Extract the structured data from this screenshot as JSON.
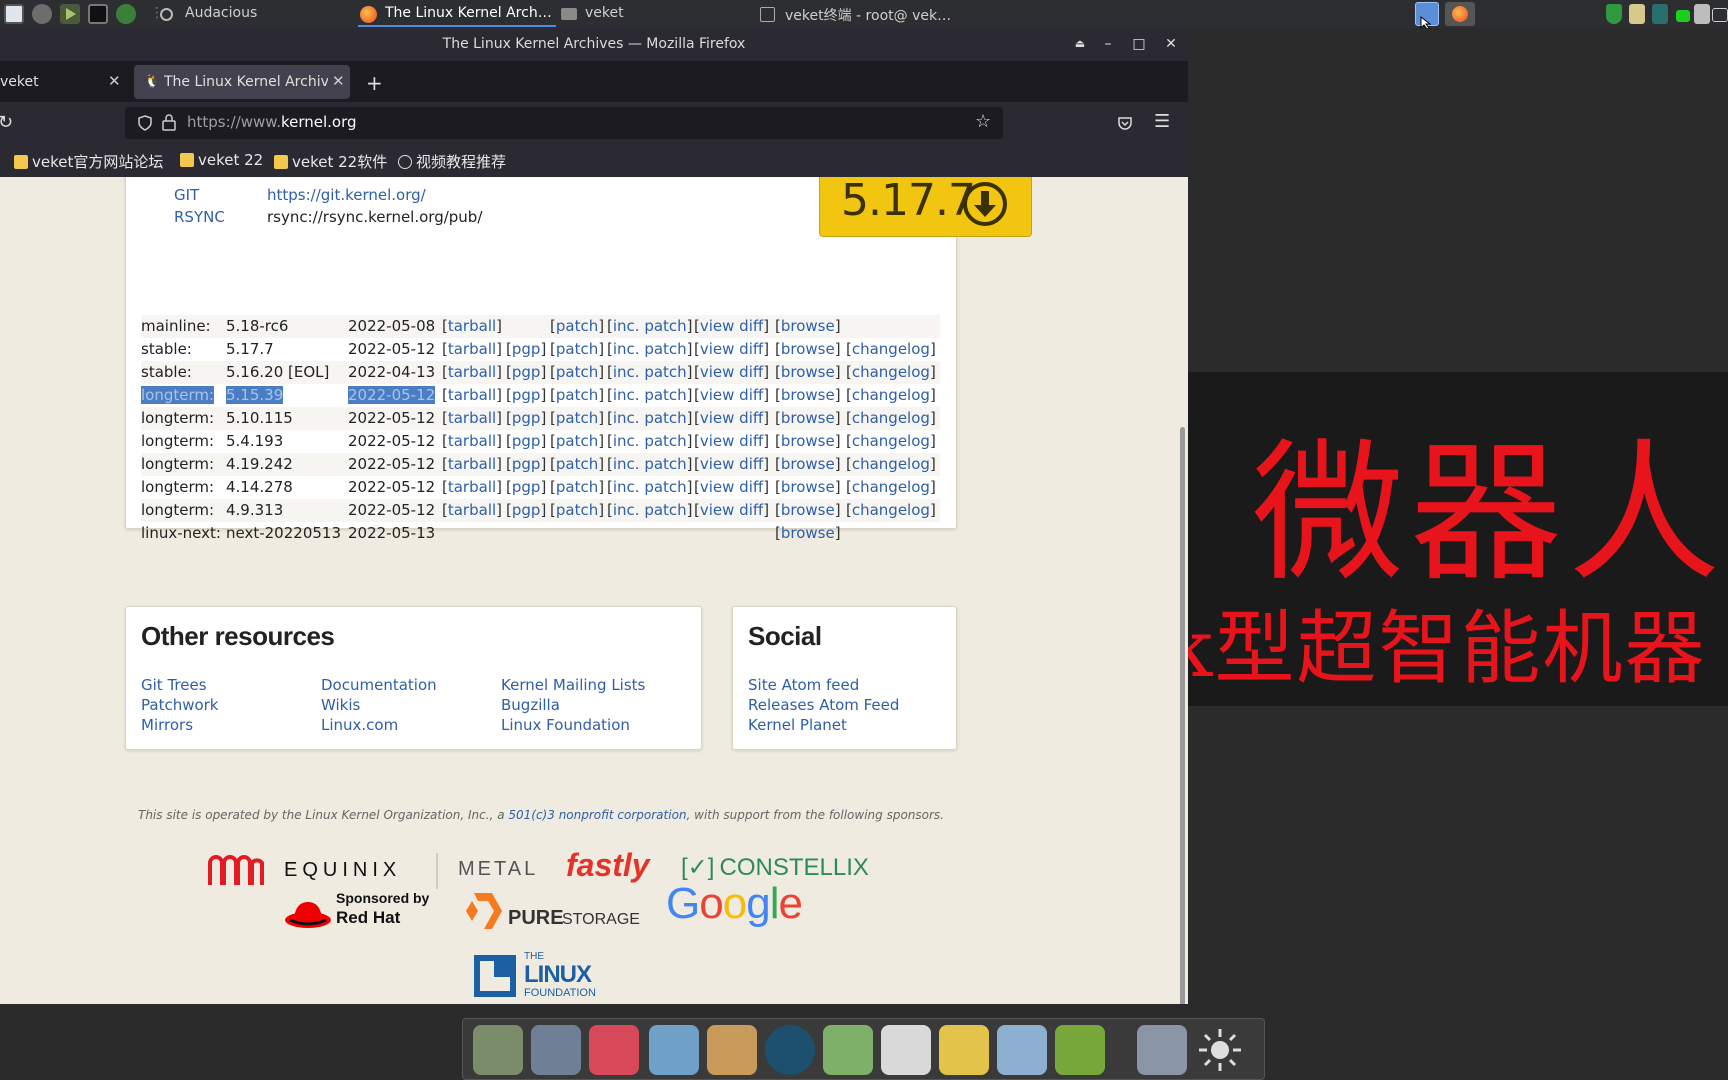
{
  "topbar": {
    "app_audacious": "Audacious",
    "task_firefox": "The Linux Kernel Arch…",
    "task_files": "veket",
    "task_terminal": "veket终端 - root@ vek…"
  },
  "window": {
    "title": "The Linux Kernel Archives — Mozilla Firefox"
  },
  "tabs": [
    {
      "label": "veket"
    },
    {
      "label": "The Linux Kernel Archive"
    }
  ],
  "urlbar": {
    "prefix": "https://www.",
    "domain": "kernel.org"
  },
  "bookmarks": [
    {
      "label": "veket官方网站论坛"
    },
    {
      "label": "veket 22"
    },
    {
      "label": "veket 22软件"
    },
    {
      "label": "视频教程推荐"
    }
  ],
  "protocols": [
    {
      "name": "GIT",
      "url": "https://git.kernel.org/"
    },
    {
      "name": "RSYNC",
      "url": "rsync://rsync.kernel.org/pub/"
    }
  ],
  "latest_release": "5.17.7",
  "releases": [
    {
      "kind": "mainline:",
      "version": "5.18-rc6",
      "date": "2022-05-08",
      "tarball": "tarball",
      "pgp": "",
      "patch": "patch",
      "inc": "inc. patch",
      "diff": "view diff",
      "browse": "browse",
      "changelog": ""
    },
    {
      "kind": "stable:",
      "version": "5.17.7",
      "date": "2022-05-12",
      "tarball": "tarball",
      "pgp": "pgp",
      "patch": "patch",
      "inc": "inc. patch",
      "diff": "view diff",
      "browse": "browse",
      "changelog": "changelog"
    },
    {
      "kind": "stable:",
      "version": "5.16.20 [EOL]",
      "date": "2022-04-13",
      "tarball": "tarball",
      "pgp": "pgp",
      "patch": "patch",
      "inc": "inc. patch",
      "diff": "view diff",
      "browse": "browse",
      "changelog": "changelog"
    },
    {
      "kind": "longterm:",
      "version": "5.15.39",
      "date": "2022-05-12",
      "tarball": "tarball",
      "pgp": "pgp",
      "patch": "patch",
      "inc": "inc. patch",
      "diff": "view diff",
      "browse": "browse",
      "changelog": "changelog"
    },
    {
      "kind": "longterm:",
      "version": "5.10.115",
      "date": "2022-05-12",
      "tarball": "tarball",
      "pgp": "pgp",
      "patch": "patch",
      "inc": "inc. patch",
      "diff": "view diff",
      "browse": "browse",
      "changelog": "changelog"
    },
    {
      "kind": "longterm:",
      "version": "5.4.193",
      "date": "2022-05-12",
      "tarball": "tarball",
      "pgp": "pgp",
      "patch": "patch",
      "inc": "inc. patch",
      "diff": "view diff",
      "browse": "browse",
      "changelog": "changelog"
    },
    {
      "kind": "longterm:",
      "version": "4.19.242",
      "date": "2022-05-12",
      "tarball": "tarball",
      "pgp": "pgp",
      "patch": "patch",
      "inc": "inc. patch",
      "diff": "view diff",
      "browse": "browse",
      "changelog": "changelog"
    },
    {
      "kind": "longterm:",
      "version": "4.14.278",
      "date": "2022-05-12",
      "tarball": "tarball",
      "pgp": "pgp",
      "patch": "patch",
      "inc": "inc. patch",
      "diff": "view diff",
      "browse": "browse",
      "changelog": "changelog"
    },
    {
      "kind": "longterm:",
      "version": "4.9.313",
      "date": "2022-05-12",
      "tarball": "tarball",
      "pgp": "pgp",
      "patch": "patch",
      "inc": "inc. patch",
      "diff": "view diff",
      "browse": "browse",
      "changelog": "changelog"
    },
    {
      "kind": "linux-next:",
      "version": "next-20220513",
      "date": "2022-05-13",
      "tarball": "",
      "pgp": "",
      "patch": "",
      "inc": "",
      "diff": "",
      "browse": "browse",
      "changelog": ""
    }
  ],
  "other_resources": {
    "title": "Other resources",
    "col1": [
      "Git Trees",
      "Patchwork",
      "Mirrors"
    ],
    "col2": [
      "Documentation",
      "Wikis",
      "Linux.com"
    ],
    "col3": [
      "Kernel Mailing Lists",
      "Bugzilla",
      "Linux Foundation"
    ]
  },
  "social": {
    "title": "Social",
    "links": [
      "Site Atom feed",
      "Releases Atom Feed",
      "Kernel Planet"
    ]
  },
  "footer": {
    "text_before": "This site is operated by the Linux Kernel Organization, Inc., a ",
    "link": "501(c)3 nonprofit corporation",
    "text_after": ", with support from the following sponsors."
  },
  "sponsors": {
    "equinix": "EQUINIX",
    "metal": "METAL",
    "fastly": "fastly",
    "constellix": "CONSTELLIX",
    "redhat_line1": "Sponsored by",
    "redhat_line2": "Red Hat",
    "pure": "PURE",
    "storage": "STORAGE",
    "google": "Google",
    "lf_the": "THE",
    "lf_linux": "LINUX",
    "lf_foundation": "FOUNDATION"
  },
  "desktop_banner": {
    "line1": "微器人",
    "line2": "k型超智能机器"
  }
}
